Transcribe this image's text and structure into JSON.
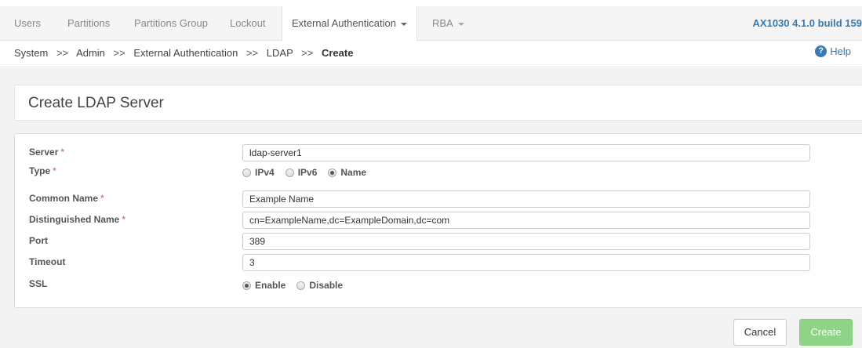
{
  "nav": {
    "tabs": [
      "Users",
      "Partitions",
      "Partitions Group",
      "Lockout",
      "External Authentication",
      "RBA"
    ],
    "active_tab": "External Authentication",
    "version": "AX1030 4.1.0 build 159"
  },
  "breadcrumb": {
    "items": [
      "System",
      "Admin",
      "External Authentication",
      "LDAP"
    ],
    "current": "Create",
    "separator": ">>",
    "help_label": "Help"
  },
  "page": {
    "title": "Create LDAP Server"
  },
  "form": {
    "server": {
      "label": "Server",
      "value": "ldap-server1"
    },
    "type": {
      "label": "Type",
      "options": [
        "IPv4",
        "IPv6",
        "Name"
      ],
      "selected": "Name"
    },
    "common_name": {
      "label": "Common Name",
      "value": "Example Name"
    },
    "distinguished_name": {
      "label": "Distinguished Name",
      "value": "cn=ExampleName,dc=ExampleDomain,dc=com"
    },
    "port": {
      "label": "Port",
      "value": "389"
    },
    "timeout": {
      "label": "Timeout",
      "value": "3"
    },
    "ssl": {
      "label": "SSL",
      "options": [
        "Enable",
        "Disable"
      ],
      "selected": "Enable"
    },
    "required_marker": "*"
  },
  "actions": {
    "cancel_label": "Cancel",
    "create_label": "Create"
  },
  "colors": {
    "link": "#337ab7",
    "required": "#d9534f",
    "create_button": "#8fd386"
  }
}
